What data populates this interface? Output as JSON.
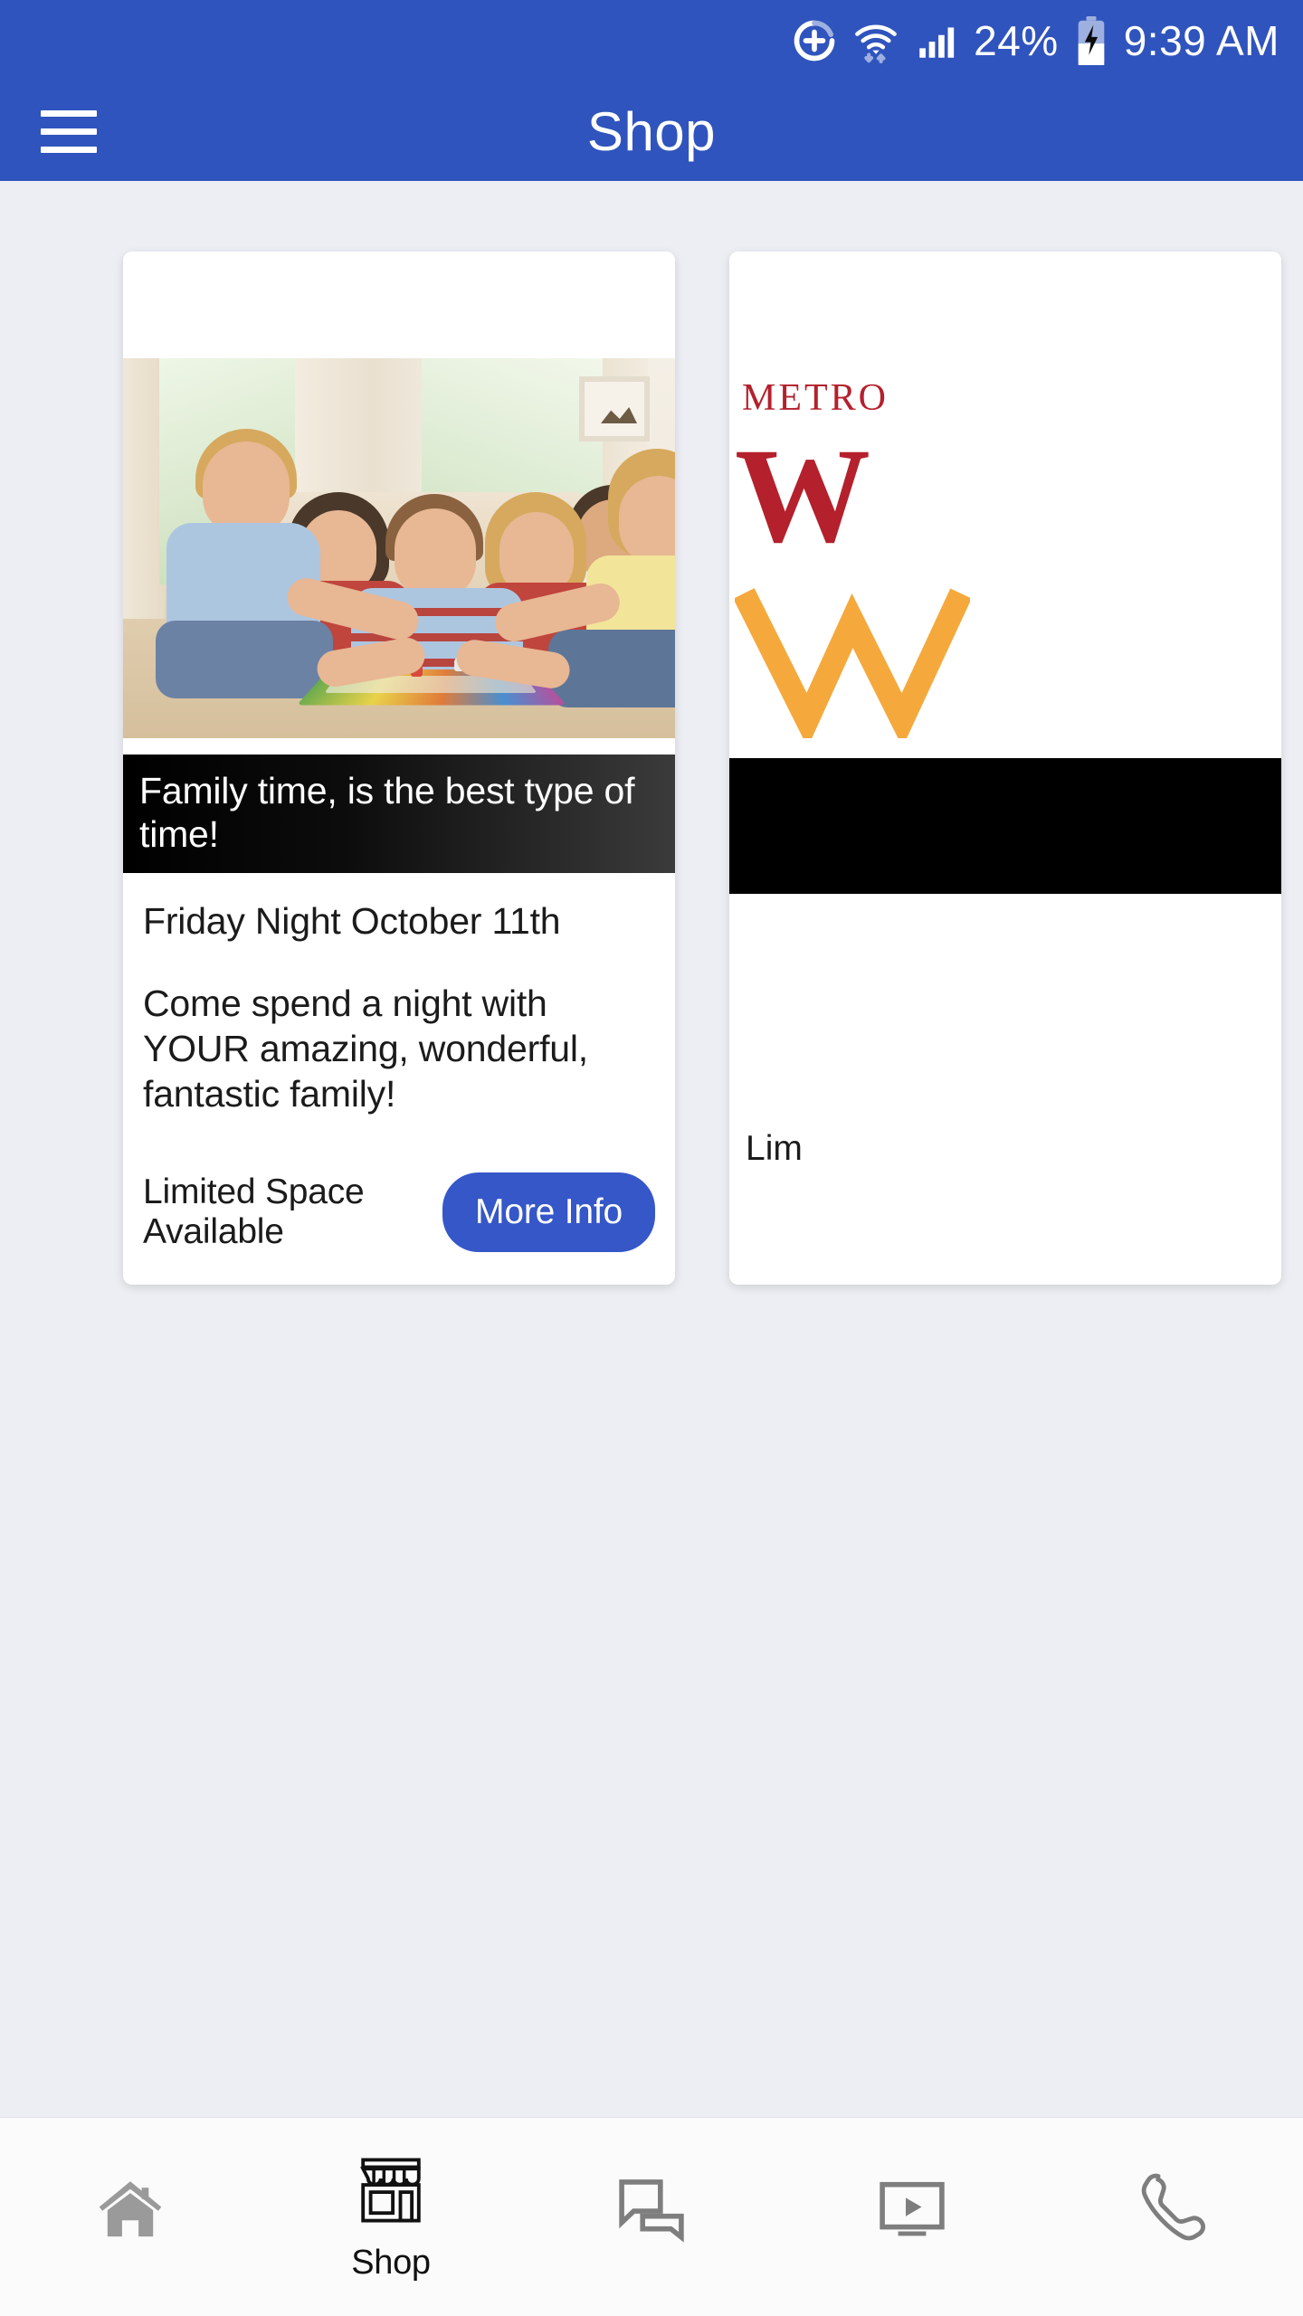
{
  "status_bar": {
    "battery_percent": "24%",
    "time": "9:39 AM",
    "icons": [
      "add-circle-icon",
      "wifi-icon",
      "cellular-signal-icon",
      "battery-charging-icon"
    ]
  },
  "app_bar": {
    "menu_icon": "hamburger-menu-icon",
    "title": "Shop"
  },
  "cards": [
    {
      "caption": "Family time, is the best type of time!",
      "date": "Friday Night October 11th",
      "description": "Come spend a night with YOUR amazing, wonderful, fantastic family!",
      "note": "Limited Space Available",
      "button_label": "More Info",
      "image_alt": "family-playing-board-game-photo"
    },
    {
      "logo_top": "METRO",
      "logo_main": "W",
      "note": "Lim"
    }
  ],
  "bottom_nav": [
    {
      "icon": "home-icon",
      "label": "",
      "active": false
    },
    {
      "icon": "store-icon",
      "label": "Shop",
      "active": true
    },
    {
      "icon": "chat-icon",
      "label": "",
      "active": false
    },
    {
      "icon": "video-icon",
      "label": "",
      "active": false
    },
    {
      "icon": "phone-icon",
      "label": "",
      "active": false
    }
  ],
  "colors": {
    "brand_blue": "#3054bd",
    "button_blue": "#3557c8",
    "page_background": "#eceef3",
    "card_background": "#ffffff",
    "logo_red": "#b4202c",
    "logo_amber": "#f5a93c",
    "nav_icon_gray": "#8a8a8a"
  }
}
